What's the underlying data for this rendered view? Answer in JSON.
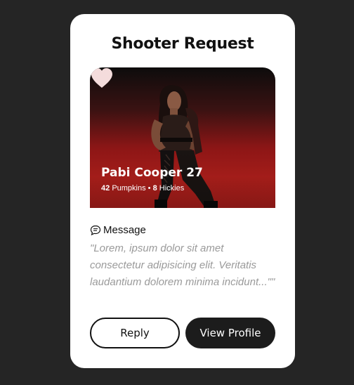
{
  "card": {
    "title": "Shooter Request",
    "profile": {
      "name_age": "Pabi Cooper 27",
      "pumpkins_count": "42",
      "pumpkins_label": "Pumpkins",
      "separator": "•",
      "hickies_count": "8",
      "hickies_label": "Hickies"
    },
    "message": {
      "icon": "chat-bubble-icon",
      "label": "Message",
      "text": "\"Lorem, ipsum dolor sit amet consectetur adipisicing elit. Veritatis laudantium dolorem minima incidunt...\"\""
    },
    "buttons": {
      "reply_label": "Reply",
      "view_profile_label": "View Profile"
    }
  },
  "colors": {
    "background": "#252525",
    "card": "#ffffff",
    "photo_red": "#b3201c",
    "primary_button": "#1c1c1c",
    "quote_text": "#9a9a9a"
  }
}
